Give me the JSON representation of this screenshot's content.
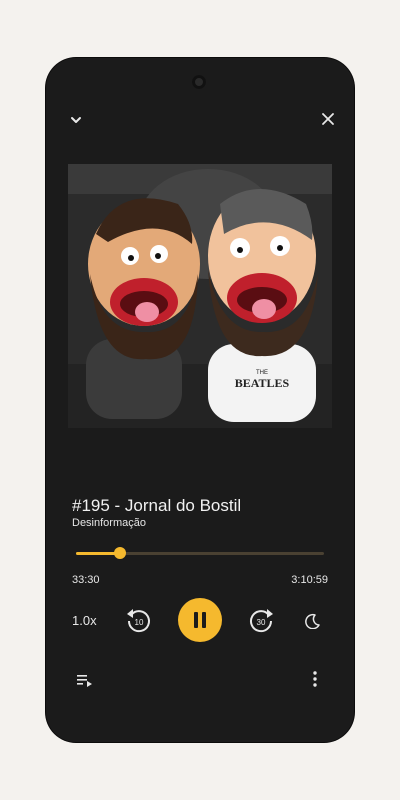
{
  "episode": {
    "title": "#195 - Jornal do Bostil",
    "podcast": "Desinformação"
  },
  "progress": {
    "elapsed": "33:30",
    "total": "3:10:59",
    "fraction": 0.176
  },
  "controls": {
    "speed": "1.0x",
    "rewind_seconds": "10",
    "forward_seconds": "30"
  },
  "icons": {
    "collapse": "chevron-down-icon",
    "close": "close-icon",
    "rewind": "replay-10-icon",
    "play_pause": "pause-icon",
    "forward": "forward-30-icon",
    "sleep": "moon-icon",
    "queue": "playlist-icon",
    "more": "more-vertical-icon"
  },
  "colors": {
    "accent": "#f5b92e",
    "background": "#1b1b1b"
  },
  "artwork": {
    "shirt_text_small": "THE",
    "shirt_text": "BEATLES"
  }
}
